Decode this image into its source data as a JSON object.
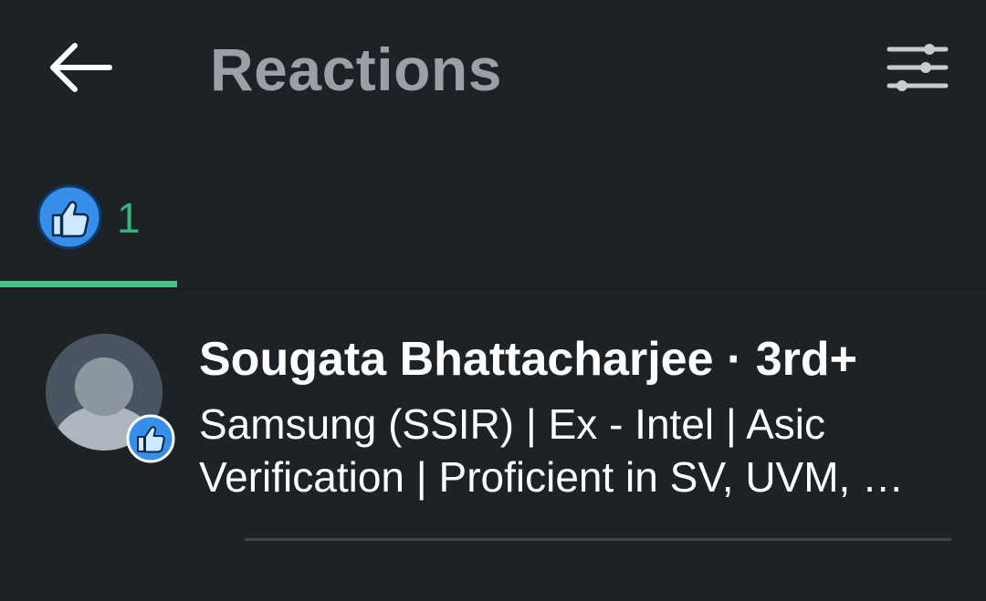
{
  "header": {
    "title": "Reactions",
    "back_icon": "arrow-left-icon",
    "filter_icon": "sliders-icon"
  },
  "tabs": [
    {
      "icon": "like-icon",
      "count": "1",
      "selected": true
    }
  ],
  "colors": {
    "background": "#1d2226",
    "accent": "#4ac082",
    "like_blue": "#378fe9",
    "title_gray": "#9aa0a6"
  },
  "reactions": [
    {
      "name": "Sougata Bhattacharjee · 3rd+",
      "headline": "Samsung (SSIR) | Ex - Intel | Asic Verification | Proficient in SV, UVM, …",
      "avatar_icon": "default-person-avatar",
      "reaction_icon": "like-icon"
    }
  ]
}
